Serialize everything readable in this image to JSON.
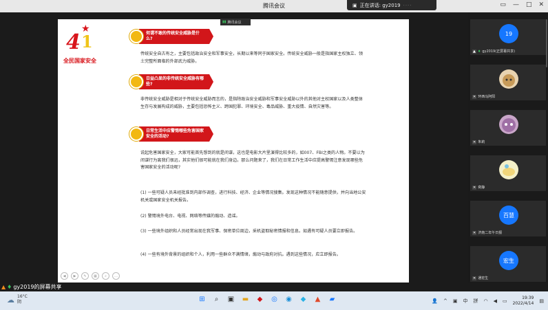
{
  "window": {
    "title": "腾讯会议",
    "speaking_label": "正在讲话: gy2019",
    "speaking_extra": "····"
  },
  "share_tag": {
    "label": "腾讯会议"
  },
  "slide": {
    "logo": {
      "big": "4",
      "small": "1",
      "caption": "全民国家安全"
    },
    "q1": {
      "heading": "何谓不敢的传统安全威胁是什么?",
      "body": "传统安全自古有之，主要包括政治安全和军事安全，长期以来等同于国家安全。传统安全威胁一般是指国家主权独立、领土完整所面临的外部武力威胁。"
    },
    "q2": {
      "heading": "日益凸显的非传统安全威胁有哪些?",
      "body": "非传统安全威胁是相对于传统安全威胁而言的，是指除政治安全威胁和军事安全威胁以外的其他对主权国家以及人类整体生存与发展构成的威胁，主要包括恐怖主义、跨国犯罪、环境安全、毒品威胁、重大疫情、自然灾害等。"
    },
    "q3": {
      "heading": "日常生活中应警惕哪些危害国家安全的活动?",
      "intro": "说起危害国家安全，大家可能首先想到的就是间谍，这也是电影大片里演得比较多的，如007、FBI之类的人物。不要以为间谍行为离我们很远，其实他们很可能就在我们身边。那么问题来了，我们在日常工作生活中应提高警惕注意发现哪些危害国家安全的活动呢?",
      "items": [
        "(1) 一些可疑人员未经批准到内部作调查，进行科技、经济、企业等情况搜集。发现这种情况不能随意提供，并向当地公安机关或国家安全机关报告。",
        "(2) 警惕境外电台、电视、网络等传媒的煽动、造谣。",
        "(3) 一些境外组织和人员经常出现在我军事、保密单位周边，采机盗取秘密情报和信息。如遇有可疑人员要立即报告。",
        "(4) 一些有境外背景的组织和个人，利用一些群众不满情绪，煽动与政府对抗。遇到这些情况，应立即报告。"
      ]
    }
  },
  "participants": [
    {
      "name": "gy2019(正屏幕共享)",
      "avatar_text": "19",
      "avatar_color": "#1677ff"
    },
    {
      "name": "环西马阿阳",
      "avatar_text": "",
      "avatar_color": "#e8d3b0"
    },
    {
      "name": "朱莉",
      "avatar_text": "",
      "avatar_color": "#c9a6c9"
    },
    {
      "name": "奕静",
      "avatar_text": "",
      "avatar_color": "#f4f0c8"
    },
    {
      "name": "济南二年午日报",
      "avatar_text": "百慧",
      "avatar_color": "#1677ff"
    },
    {
      "name": "通宏生",
      "avatar_text": "宏生",
      "avatar_color": "#1677ff"
    }
  ],
  "sharebar": {
    "label": "gy2019的屏幕共享"
  },
  "taskbar": {
    "weather_temp": "16°C",
    "weather_desc": "阴",
    "ime": "中",
    "layout": "拼",
    "time": "19:39",
    "date": "2022/4/14"
  }
}
